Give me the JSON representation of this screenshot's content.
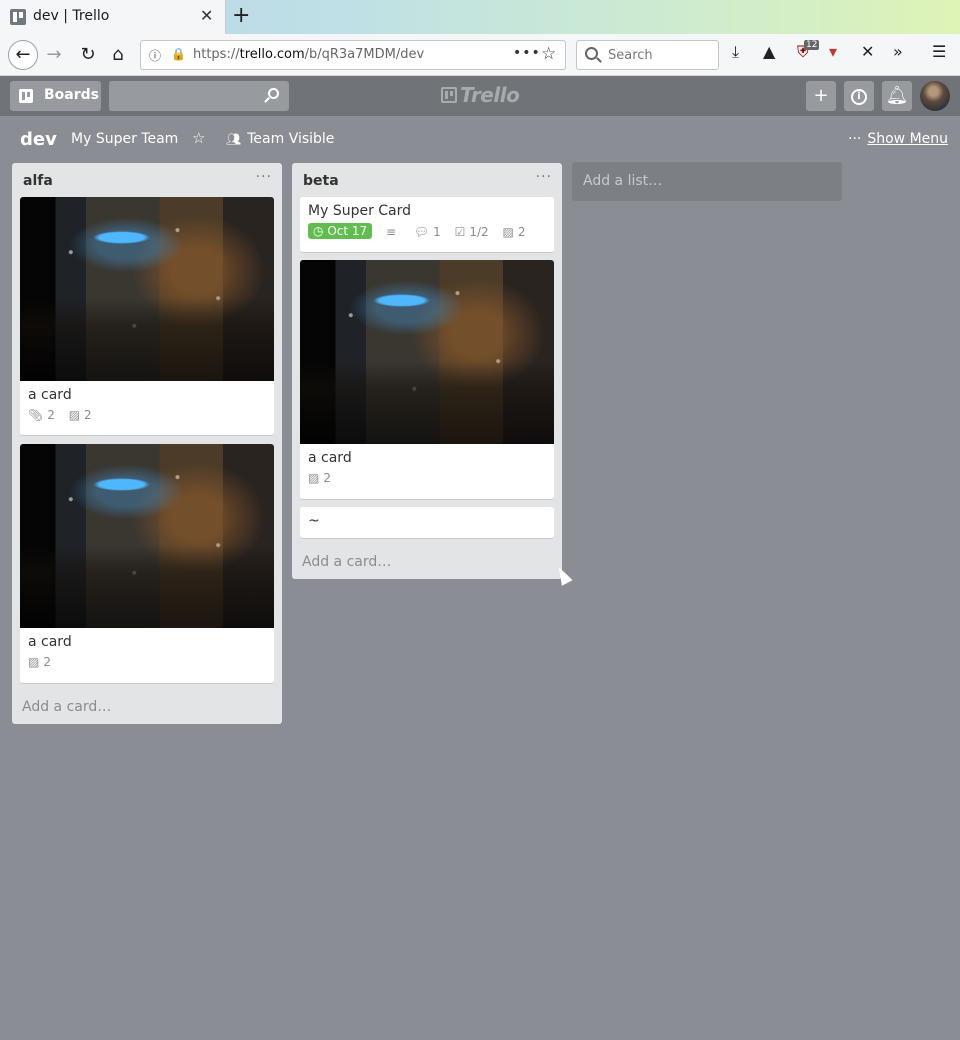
{
  "browser": {
    "tab_title": "dev | Trello",
    "tab_close": "✕",
    "new_tab": "+",
    "url_prefix": "https://",
    "url_host": "trello.com",
    "url_path": "/b/qR3a7MDM/dev",
    "search_placeholder": "Search",
    "ublock_count": "12"
  },
  "trello": {
    "boards_label": "Boards",
    "logo_text": "Trello",
    "add_label": "+",
    "info_label": "i"
  },
  "board": {
    "title": "dev",
    "team": "My Super Team",
    "visibility": "Team Visible",
    "show_menu_dots": "···",
    "show_menu": "Show Menu"
  },
  "lists": [
    {
      "title": "alfa",
      "menu": "···",
      "add_card": "Add a card…",
      "cards": [
        {
          "title": "a card",
          "attachments": "2",
          "stickers": "2"
        },
        {
          "title": "a card",
          "stickers": "2"
        }
      ]
    },
    {
      "title": "beta",
      "menu": "···",
      "add_card": "Add a card…",
      "cards": [
        {
          "title": "My Super Card",
          "due": "Oct 17",
          "comments": "1",
          "checklist": "1/2",
          "stickers": "2"
        },
        {
          "title": "a card",
          "stickers": "2"
        },
        {
          "title": "~"
        }
      ]
    }
  ],
  "add_list": "Add a list…",
  "colors": {
    "board_bg": "#8a8e94",
    "header_bg": "#707479",
    "list_bg": "#e2e4e6",
    "due_green": "#61bd4f"
  }
}
